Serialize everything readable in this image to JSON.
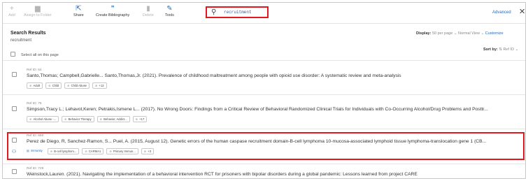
{
  "toolbar": {
    "add": "Add",
    "assign_to_folder": "Assign to Folder",
    "share": "Share",
    "create_bibliography": "Create Bibliography",
    "delete": "Delete",
    "tools": "Tools",
    "search_value": "recruitment",
    "advanced": "Advanced",
    "close": "✕"
  },
  "results": {
    "title": "Search Results",
    "query": "recruitment",
    "select_all": "Select all on this page",
    "display_label": "Display:",
    "per_page": "50 per page",
    "view": "Normal View",
    "customize": "Customize",
    "sort_label": "Sort by:",
    "sort_value": "Ref ID"
  },
  "rows": [
    {
      "refid": "Ref ID: 54",
      "citation": "Santo,Thomas; Campbell,Gabrielle... Santo,Thomas,Jr. (2021). Prevalence of childhood maltreatment among people with opioid use disorder: A systematic review and meta-analysis",
      "tags": [
        "Adult",
        "Child",
        "Child Abuse",
        "+12"
      ]
    },
    {
      "refid": "Ref ID: 75",
      "citation": "Simpson,Tracy L.; Lehavot,Keren; Petrakis,Ismene L... (2017). No Wrong Doors: Findings from a Critical Review of Behavioral Randomized Clinical Trials for Individuals with Co-Occurring Alcohol/Drug Problems and Posttr...",
      "tags": [
        "Alcohol Abuse -...",
        "Behavior Therapy",
        "Behavior, Addict...",
        "+17"
      ]
    },
    {
      "refid": "Ref ID: 650",
      "citation": "Perez de Diego, R, Sanchez-Ramon, S... Puel, A. (2015, August 12). Genetic errors of the human caspase recruitment domain-B-cell lymphoma 10-mucosa-associated lymphoid tissue lymphoma-translocation gene 1 (CB...",
      "folder": "immunity",
      "tags": [
        "B-cell lymphom...",
        "CARMA1",
        "Primary Immun...",
        "+3"
      ]
    },
    {
      "refid": "Ref ID: 728",
      "citation": "Weinstock,Lauren. (2021). Navigating the implementation of a behavioral intervention RCT for prisoners with bipolar disorders during a global pandemic: Lessons learned from project CARE"
    }
  ]
}
